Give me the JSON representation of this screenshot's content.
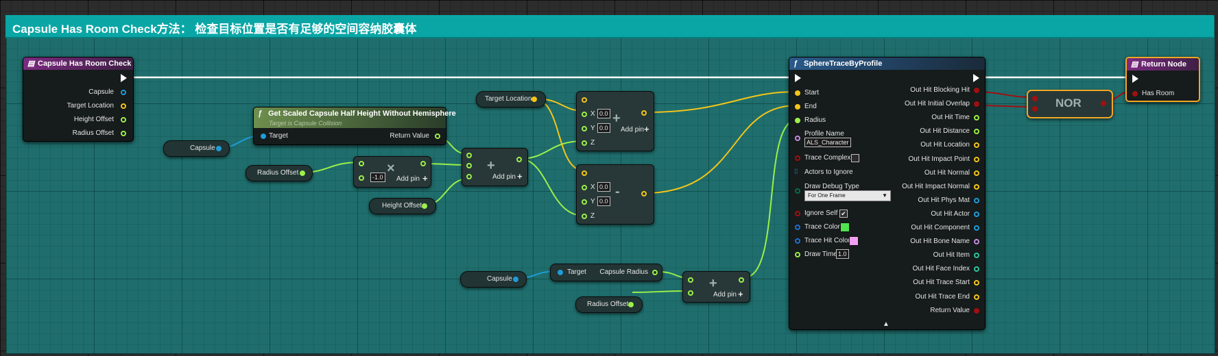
{
  "comment": {
    "title": "Capsule Has Room Check方法： 检查目标位置是否有足够的空间容纳胶囊体",
    "color": "#0aa6a6"
  },
  "colors": {
    "vector": "#f5c518",
    "float": "#9cf04a",
    "object": "#1e9cd7",
    "bool": "#a01010",
    "exec": "#ffffff",
    "struct": "#1f6fd6"
  },
  "entry": {
    "title": "Capsule Has Room Check",
    "icon": "function-entry-icon",
    "outputs": [
      "Capsule",
      "Target Location",
      "Height Offset",
      "Radius Offset"
    ]
  },
  "half_height": {
    "title": "Get Scaled Capsule Half Height Without Hemisphere",
    "subtitle": "Target is Capsule Collision",
    "icon": "function-icon",
    "input": "Target",
    "output": "Return Value"
  },
  "getters": {
    "capsule1": "Capsule",
    "radius_offset1": "Radius Offset",
    "height_offset": "Height Offset",
    "target_location": "Target Location",
    "capsule2": "Capsule",
    "radius_offset2": "Radius Offset"
  },
  "multiply": {
    "operator": "×",
    "value": "-1.0",
    "add_pin": "Add pin"
  },
  "add_float": {
    "operator": "+",
    "add_pin": "Add pin"
  },
  "add_vector": {
    "operator": "+",
    "x_label": "X",
    "y_label": "Y",
    "z_label": "Z",
    "x": "0.0",
    "y": "0.0",
    "add_pin": "Add pin"
  },
  "sub_vector": {
    "operator": "-",
    "x_label": "X",
    "y_label": "Y",
    "z_label": "Z",
    "x": "0.0",
    "y": "0.0"
  },
  "capsule_radius": {
    "input": "Target",
    "output": "Capsule Radius"
  },
  "add_radius": {
    "operator": "+",
    "add_pin": "Add pin"
  },
  "sphere_trace": {
    "title": "SphereTraceByProfile",
    "icon": "function-icon",
    "inputs": {
      "start": "Start",
      "end": "End",
      "radius": "Radius",
      "profile_name": "Profile Name",
      "profile_value": "ALS_Character",
      "trace_complex": "Trace Complex",
      "actors_to_ignore": "Actors to Ignore",
      "draw_debug_type": "Draw Debug Type",
      "draw_debug_value": "For One Frame",
      "ignore_self": "Ignore Self",
      "trace_color": "Trace Color",
      "trace_hit_color": "Trace Hit Color",
      "draw_time": "Draw Time",
      "draw_time_value": "1.0"
    },
    "trace_color_hex": "#4fe34f",
    "trace_hit_color_hex": "#f29ff2",
    "outputs": [
      "Out Hit Blocking Hit",
      "Out Hit Initial Overlap",
      "Out Hit Time",
      "Out Hit Distance",
      "Out Hit Location",
      "Out Hit Impact Point",
      "Out Hit Normal",
      "Out Hit Impact Normal",
      "Out Hit Phys Mat",
      "Out Hit Actor",
      "Out Hit Component",
      "Out Hit Bone Name",
      "Out Hit Item",
      "Out Hit Face Index",
      "Out Hit Trace Start",
      "Out Hit Trace End",
      "Return Value"
    ]
  },
  "nor": {
    "label": "NOR"
  },
  "return_node": {
    "title": "Return Node",
    "icon": "function-return-icon",
    "input": "Has Room"
  }
}
